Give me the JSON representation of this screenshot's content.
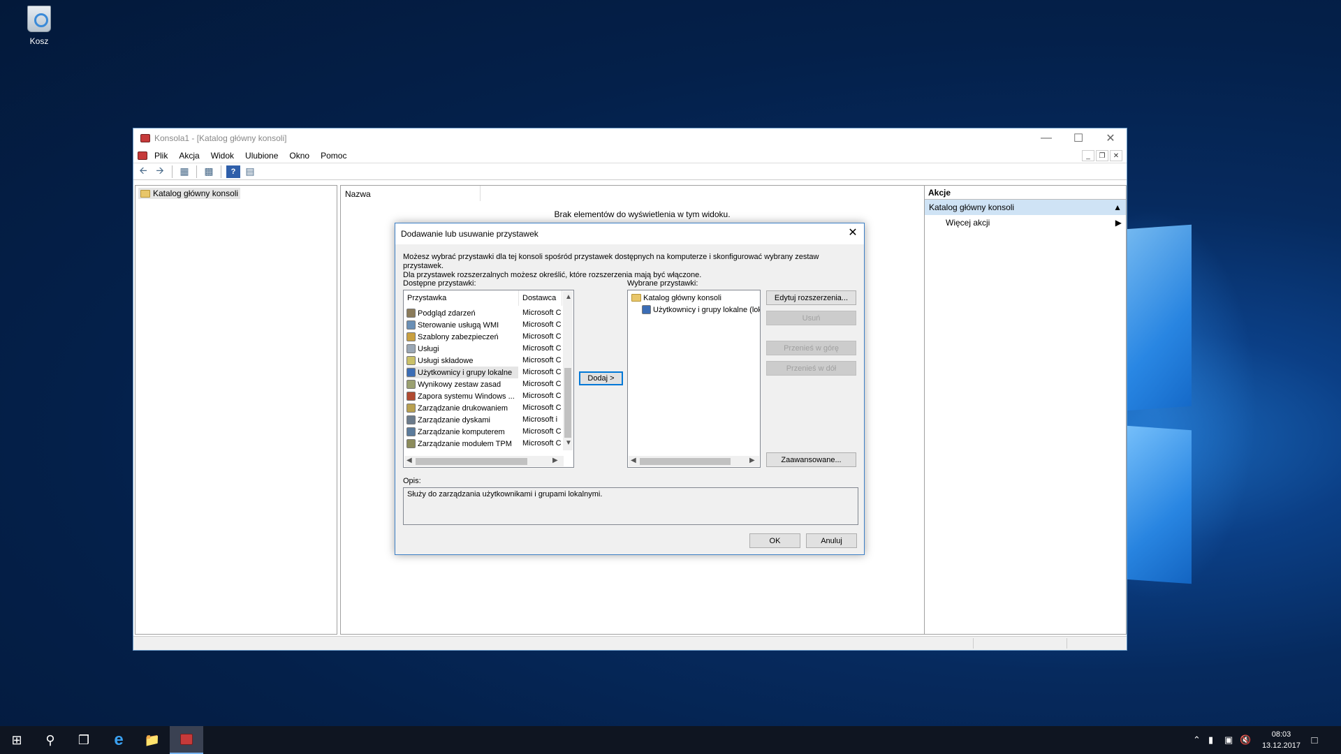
{
  "desktop": {
    "recycle_bin": "Kosz"
  },
  "window": {
    "title": "Konsola1 - [Katalog główny konsoli]",
    "menu": [
      "Plik",
      "Akcja",
      "Widok",
      "Ulubione",
      "Okno",
      "Pomoc"
    ],
    "tree_root": "Katalog główny konsoli",
    "column_name": "Nazwa",
    "empty_text": "Brak elementów do wyświetlenia w tym widoku.",
    "actions_header": "Akcje",
    "actions_selected": "Katalog główny konsoli",
    "actions_more": "Więcej akcji"
  },
  "dialog": {
    "title": "Dodawanie lub usuwanie przystawek",
    "description_line1": "Możesz wybrać przystawki dla tej konsoli spośród przystawek dostępnych na komputerze i skonfigurować wybrany zestaw przystawek.",
    "description_line2": "Dla przystawek rozszerzalnych możesz określić, które rozszerzenia mają być włączone.",
    "available_label": "Dostępne przystawki:",
    "selected_label": "Wybrane przystawki:",
    "col_snapin": "Przystawka",
    "col_vendor": "Dostawca",
    "available": [
      {
        "name": "Podgląd zdarzeń",
        "vendor": "Microsoft C",
        "icon": "event-viewer-icon"
      },
      {
        "name": "Sterowanie usługą WMI",
        "vendor": "Microsoft C",
        "icon": "wmi-icon"
      },
      {
        "name": "Szablony zabezpieczeń",
        "vendor": "Microsoft C",
        "icon": "security-templates-icon"
      },
      {
        "name": "Usługi",
        "vendor": "Microsoft C",
        "icon": "services-icon"
      },
      {
        "name": "Usługi składowe",
        "vendor": "Microsoft C",
        "icon": "component-services-icon"
      },
      {
        "name": "Użytkownicy i grupy lokalne",
        "vendor": "Microsoft C",
        "icon": "users-groups-icon"
      },
      {
        "name": "Wynikowy zestaw zasad",
        "vendor": "Microsoft C",
        "icon": "rsop-icon"
      },
      {
        "name": "Zapora systemu Windows ...",
        "vendor": "Microsoft C",
        "icon": "firewall-icon"
      },
      {
        "name": "Zarządzanie drukowaniem",
        "vendor": "Microsoft C",
        "icon": "print-icon"
      },
      {
        "name": "Zarządzanie dyskami",
        "vendor": "Microsoft i",
        "icon": "disk-icon"
      },
      {
        "name": "Zarządzanie komputerem",
        "vendor": "Microsoft C",
        "icon": "computer-management-icon"
      },
      {
        "name": "Zarządzanie modułem TPM",
        "vendor": "Microsoft C",
        "icon": "tpm-icon"
      }
    ],
    "selected_root": "Katalog główny konsoli",
    "selected_child": "Użytkownicy i grupy lokalne (lok",
    "add_button": "Dodaj >",
    "edit_ext_button": "Edytuj rozszerzenia...",
    "remove_button": "Usuń",
    "move_up_button": "Przenieś w górę",
    "move_down_button": "Przenieś w dół",
    "advanced_button": "Zaawansowane...",
    "opis_label": "Opis:",
    "opis_text": "Służy do zarządzania użytkownikami i grupami lokalnymi.",
    "ok_button": "OK",
    "cancel_button": "Anuluj"
  },
  "taskbar": {
    "time": "08:03",
    "date": "13.12.2017"
  },
  "colors": {
    "accent": "#0078d7",
    "selection": "#cfe3f5",
    "taskbar": "#0f1521"
  }
}
